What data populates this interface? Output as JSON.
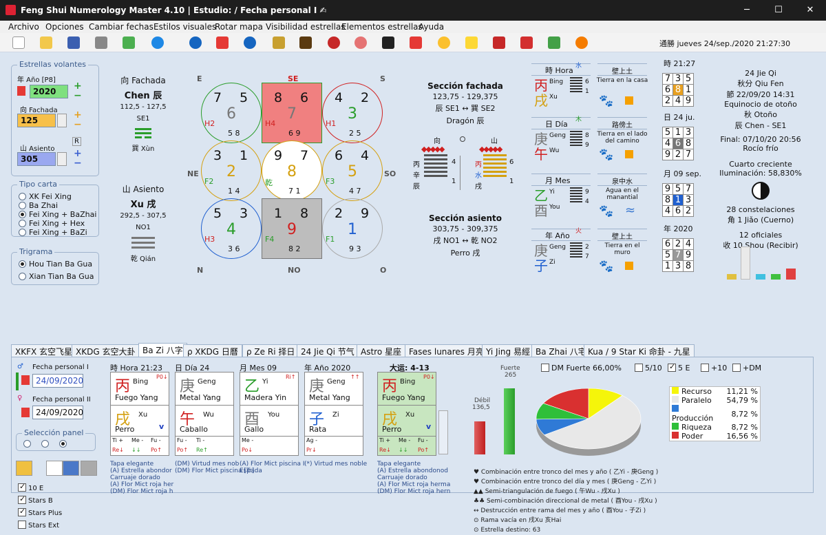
{
  "window": {
    "title": "Feng Shui Numerology Master 4.10  |  Estudio:  / Fecha personal I ✍",
    "min": "─",
    "max": "☐",
    "close": "✕"
  },
  "menu": [
    "Archivo",
    "Opciones",
    "Cambiar fechas",
    "Estilos visuales",
    "Rotar mapa",
    "Visibilidad estrellas",
    "Elementos estrellas",
    "Ayuda"
  ],
  "toolbar": {
    "datetime": "通勝 jueves 24/sep./2020 21:27:30"
  },
  "flying": {
    "legend": "Estrellas volantes",
    "year_label": "年 Año [P8]",
    "year": "2020",
    "fachada_label": "向 Fachada",
    "fachada": "125",
    "asiento_label": "山 Asiento",
    "asiento": "305",
    "plus": "+",
    "minus": "−",
    "r": "R"
  },
  "tipo": {
    "legend": "Tipo carta",
    "options": [
      "XK Fei Xing",
      "Ba Zhai",
      "Fei Xing + BaZhai",
      "Fei Xing + Hex",
      "Fei Xing + BaZi"
    ]
  },
  "trigrama": {
    "legend": "Trigrama",
    "options": [
      "Hou Tian Ba Gua",
      "Xian Tian Ba Gua"
    ]
  },
  "facade": {
    "title": "向 Fachada",
    "name": "Chen 辰",
    "range": "112,5 - 127,5",
    "code": "SE1",
    "trigram": "巽 Xùn"
  },
  "seat": {
    "title": "山 Asiento",
    "name": "Xu 戌",
    "range": "292,5 - 307,5",
    "code": "NO1",
    "trigram": "乾 Qián"
  },
  "dirs": {
    "E": "E",
    "SE": "SE",
    "S": "S",
    "NE": "NE",
    "SO": "SO",
    "N": "N",
    "NO": "NO",
    "O": "O"
  },
  "palaces": [
    {
      "tl": "7",
      "tr": "5",
      "c": "6",
      "lbl": "H2",
      "b": "5 8"
    },
    {
      "tl": "8",
      "tr": "6",
      "c": "7",
      "lbl": "H4",
      "b": "6 9"
    },
    {
      "tl": "4",
      "tr": "2",
      "c": "3",
      "lbl": "H1",
      "b": "2 5"
    },
    {
      "tl": "3",
      "tr": "1",
      "c": "2",
      "lbl": "F2",
      "b": "1 4"
    },
    {
      "tl": "9",
      "tr": "7",
      "c": "8",
      "lbl": "乾",
      "b": "7 1"
    },
    {
      "tl": "6",
      "tr": "4",
      "c": "5",
      "lbl": "F3",
      "b": "4 7"
    },
    {
      "tl": "5",
      "tr": "3",
      "c": "4",
      "lbl": "H3",
      "b": "3 6"
    },
    {
      "tl": "1",
      "tr": "8",
      "c": "9",
      "lbl": "F4",
      "b": "8 2"
    },
    {
      "tl": "2",
      "tr": "9",
      "c": "1",
      "lbl": "F1",
      "b": "9 3"
    }
  ],
  "section_f": {
    "title": "Sección fachada",
    "range": "123,75 - 129,375",
    "link": "辰 SE1 ↔ 巽 SE2",
    "name": "Dragón 辰"
  },
  "section_a": {
    "title": "Sección asiento",
    "range": "303,75 - 309,375",
    "link": "戌 NO1 ↔ 乾 NO2",
    "name": "Perro 戌"
  },
  "hex": {
    "l_top": "向",
    "r_top": "山",
    "l1": "丙",
    "l1n": "4",
    "l2": "辛",
    "l3": "辰",
    "l3n": "1",
    "r1": "丙",
    "r1n": "6",
    "r2": "水",
    "r3": "戌",
    "r3n": "1"
  },
  "hour": {
    "title": "時 Hora",
    "s1": "丙",
    "p1": "Bing",
    "s2": "戌",
    "p2": "Xu",
    "n1": "6",
    "n2": "1",
    "el": "Tierra en la casa",
    "mh": "時 21:27",
    "sq": [
      "7",
      "3",
      "5",
      "6",
      "8",
      "1",
      "2",
      "4",
      "9"
    ]
  },
  "day": {
    "title": "日 Día",
    "s1": "庚",
    "p1": "Geng",
    "s2": "午",
    "p2": "Wu",
    "n1": "8",
    "n2": "9",
    "el": "Tierra en el lado del camino",
    "mh": "日 24 ju.",
    "sq": [
      "5",
      "1",
      "3",
      "4",
      "6",
      "8",
      "9",
      "2",
      "7"
    ]
  },
  "month": {
    "title": "月 Mes",
    "s1": "乙",
    "p1": "Yi",
    "s2": "酉",
    "p2": "You",
    "n1": "9",
    "n2": "4",
    "el": "Agua en el manantial",
    "mh": "月 09 sep.",
    "sq": [
      "9",
      "5",
      "7",
      "8",
      "1",
      "3",
      "4",
      "6",
      "2"
    ]
  },
  "year": {
    "title": "年 Año",
    "s1": "庚",
    "p1": "Geng",
    "s2": "子",
    "p2": "Zi",
    "n1": "2",
    "n2": "7",
    "el": "Tierra en el muro",
    "mh": "年 2020",
    "sq": [
      "6",
      "2",
      "4",
      "5",
      "7",
      "9",
      "1",
      "3",
      "8"
    ]
  },
  "hcap": [
    "壁上土",
    "路傍土",
    "泉中水",
    "壁上土"
  ],
  "right": {
    "jieqi": "24 Jie Qi",
    "l2": "秋分 Qiu Fen",
    "l3": "節 22/09/20 14:31",
    "l4": "Equinocio de otoño",
    "l5": "秋 Otoño",
    "l6": "辰 Chen - SE1",
    "l7": "Final: 07/10/20 20:56",
    "l8": "Rocío frío",
    "moon": "Cuarto creciente",
    "illum": "Iluminación: 58,830%",
    "c1": "28 constelaciones",
    "c2": "角 1 Jiǎo (Cuerno)",
    "o1": "12 oficiales",
    "o2": "收 10 Shou (Recibir)"
  },
  "tabs": [
    "XKFX 玄空飞星",
    "XKDG 玄空大卦",
    "Ba Zi 八字",
    "ρ XKDG 日曆",
    "ρ Ze Ri 择日",
    "24 Jie Qi 节气",
    "Astro 星座",
    "Fases lunares 月亮",
    "Yi Jing 易經",
    "Ba Zhai 八宅",
    "Kua / 9 Star Ki 命卦 - 九星"
  ],
  "bazi": {
    "p1": "Fecha personal I",
    "d1": "24/09/2020",
    "p2": "Fecha personal II",
    "d2": "24/09/2020",
    "sel": "Selección panel",
    "checks": [
      "10 E",
      "Stars B",
      "Stars Plus",
      "Stars Ext"
    ],
    "cols": [
      {
        "h": "時 Hora 21:23",
        "s": "丙",
        "sp": "Bing",
        "se": "Fuego Yang",
        "b": "戌",
        "bp": "Xu",
        "be": "Perro",
        "tag": "P0↓",
        "r1": "Ti +",
        "r2": "Me -",
        "r3": "Fu -",
        "r4": "Re↓",
        "r5": "↓↓",
        "r6": "Po↑"
      },
      {
        "h": "日 Día 24",
        "s": "庚",
        "sp": "Geng",
        "se": "Metal Yang",
        "b": "午",
        "bp": "Wu",
        "be": "Caballo",
        "tag": "",
        "r1": "Fu -",
        "r2": "Ti -",
        "r3": "",
        "r4": "Po↑",
        "r5": "Re↑",
        "r6": ""
      },
      {
        "h": "月 Mes 09",
        "s": "乙",
        "sp": "Yi",
        "se": "Madera Yin",
        "b": "酉",
        "bp": "You",
        "be": "Gallo",
        "tag": "Ri↑",
        "r1": "Me -",
        "r2": "",
        "r3": "",
        "r4": "Po↓",
        "r5": "",
        "r6": ""
      },
      {
        "h": "年 Año 2020",
        "s": "庚",
        "sp": "Geng",
        "se": "Metal Yang",
        "b": "子",
        "bp": "Zi",
        "be": "Rata",
        "tag": "↑↑",
        "r1": "Ag -",
        "r2": "",
        "r3": "",
        "r4": "Pr↓",
        "r5": "",
        "r6": ""
      },
      {
        "h": "大运: 4-13",
        "s": "丙",
        "sp": "Bing",
        "se": "Fuego Yang",
        "b": "戌",
        "bp": "Xu",
        "be": "Perro",
        "tag": "P0↓",
        "r1": "Ti +",
        "r2": "Me -",
        "r3": "Fu -",
        "r4": "Re↓",
        "r5": "↓↓",
        "r6": "Po↑"
      }
    ],
    "notes1": [
      "Tapa elegante",
      "(A) Estrella abondor",
      "Carruaje dorado",
      "(A) Flor Mict roja her",
      "(DM) Flor Mict roja h"
    ],
    "notes2": [
      "(DM) Virtud mes nob",
      "(DM) Flor Mict piscina [Tr]"
    ],
    "notes3": [
      "(A) Flor Mict piscina I",
      "Espada"
    ],
    "notes4": [
      "(*) Virtud mes noble"
    ],
    "notes5": [
      "Tapa elegante",
      "(A) Estrella abondonod",
      "Carruaje dorado",
      "(A) Flor Mict roja herma",
      "(DM) Flor Mict roja hern"
    ],
    "fuerte": "Fuerte",
    "fuerte_v": "265",
    "debil": "Débil",
    "debil_v": "136,5",
    "dm": "DM Fuerte 66,00%",
    "c510": "5/10",
    "c5e": "5 E",
    "c10": "+10",
    "cdm": "+DM",
    "combos": [
      "♥ Combinación entre tronco del mes y año ( 乙Yi - 庚Geng )",
      "♥ Combinación entre tronco del día y mes ( 庚Geng - 乙Yi )",
      "▲▲ Semi-triangulación de fuego ( 午Wu - 戌Xu )",
      "♣♣ Semi-combinación direccional de metal ( 酉You - 戌Xu )",
      "↔ Destrucción entre rama del mes y año ( 酉You - 子Zi )",
      "⊙ Rama vacía en 戌Xu 亥Hai",
      "⊙ Estrella destino: 63"
    ]
  },
  "chart_data": {
    "type": "pie",
    "categories": [
      "Recurso",
      "Paralelo",
      "Producción",
      "Riqueza",
      "Poder"
    ],
    "values": [
      11.21,
      54.79,
      8.72,
      8.72,
      16.56
    ],
    "labels": [
      "11,21 %",
      "54,79 %",
      "8,72 %",
      "8,72 %",
      "16,56 %"
    ],
    "colors": [
      "#f5f50a",
      "#e8e8e8",
      "#2f7ad6",
      "#2fbf3a",
      "#d93030"
    ]
  }
}
